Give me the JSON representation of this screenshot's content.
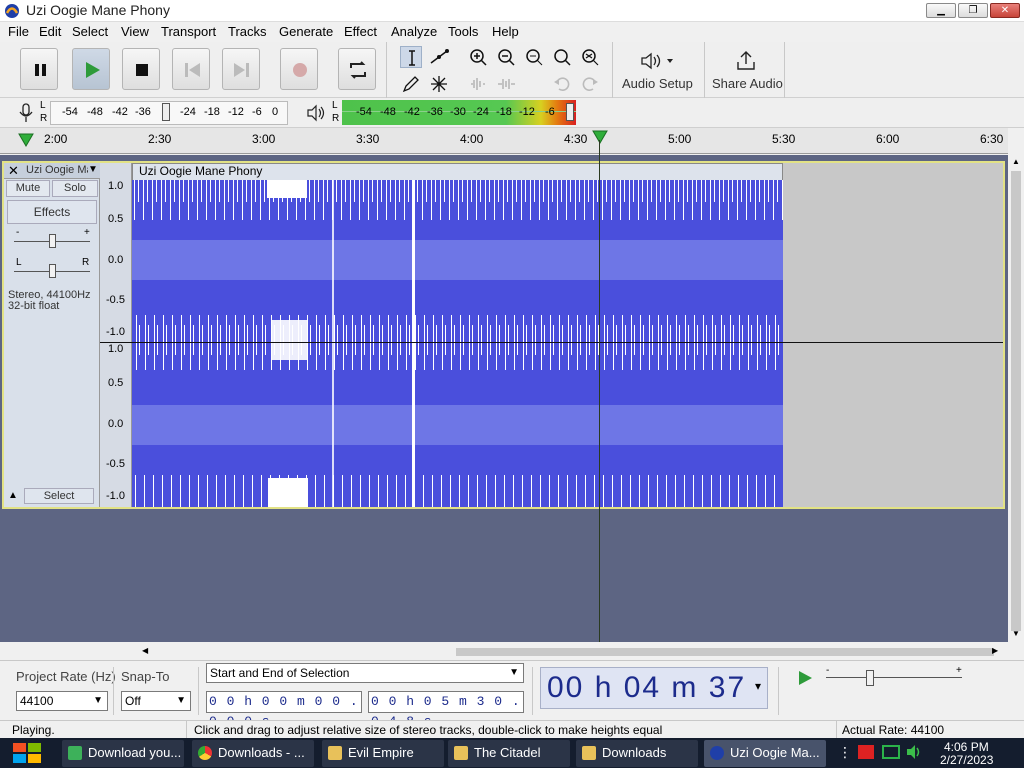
{
  "window": {
    "title": "Uzi Oogie Mane Phony"
  },
  "menu": [
    "File",
    "Edit",
    "Select",
    "View",
    "Transport",
    "Tracks",
    "Generate",
    "Effect",
    "Analyze",
    "Tools",
    "Help"
  ],
  "toolbar": {
    "audio_setup": "Audio Setup",
    "share_audio": "Share Audio"
  },
  "meters": {
    "record_ticks": [
      "-54",
      "-48",
      "-42",
      "-36",
      "-24",
      "-18",
      "-12",
      "-6",
      "0"
    ],
    "play_ticks": [
      "-54",
      "-48",
      "-42",
      "-36",
      "-30",
      "-24",
      "-18",
      "-12",
      "-6"
    ],
    "lr": [
      "L",
      "R"
    ]
  },
  "ruler": {
    "labels": [
      "2:00",
      "2:30",
      "3:00",
      "3:30",
      "4:00",
      "4:30",
      "5:00",
      "5:30",
      "6:00",
      "6:30"
    ]
  },
  "track": {
    "name": "Uzi Oogie Ma",
    "clip_name": "Uzi Oogie Mane Phony",
    "mute": "Mute",
    "solo": "Solo",
    "effects": "Effects",
    "info1": "Stereo, 44100Hz",
    "info2": "32-bit float",
    "select": "Select",
    "scale": [
      "1.0",
      "0.5",
      "0.0",
      "-0.5",
      "-1.0",
      "1.0",
      "0.5",
      "0.0",
      "-0.5",
      "-1.0"
    ],
    "gain_minus": "-",
    "gain_plus": "+",
    "pan_l": "L",
    "pan_r": "R"
  },
  "bottom": {
    "project_rate_label": "Project Rate (Hz)",
    "snap_label": "Snap-To",
    "rate_value": "44100",
    "snap_value": "Off",
    "selection_mode": "Start and End of Selection",
    "sel_start": "0 0 h 0 0 m 0 0 . 0 0 0 s",
    "sel_end": "0 0 h 0 5 m 3 0 . 0 4 8 s",
    "audio_time": "00 h 04 m 37 s"
  },
  "status": {
    "left": "Playing.",
    "middle": "Click and drag to adjust relative size of stereo tracks, double-click to make heights equal",
    "right": "Actual Rate: 44100"
  },
  "taskbar": {
    "tasks": [
      "Download you...",
      "Downloads - ...",
      "Evil Empire",
      "The Citadel",
      "Downloads",
      "Uzi Oogie Ma..."
    ],
    "time": "4:06 PM",
    "date": "2/27/2023"
  },
  "colors": {
    "waveform": "#4a4fdc",
    "waveform_rms": "#6e76e6",
    "track_bg": "#5d6583",
    "selection_border": "#e2e285"
  }
}
